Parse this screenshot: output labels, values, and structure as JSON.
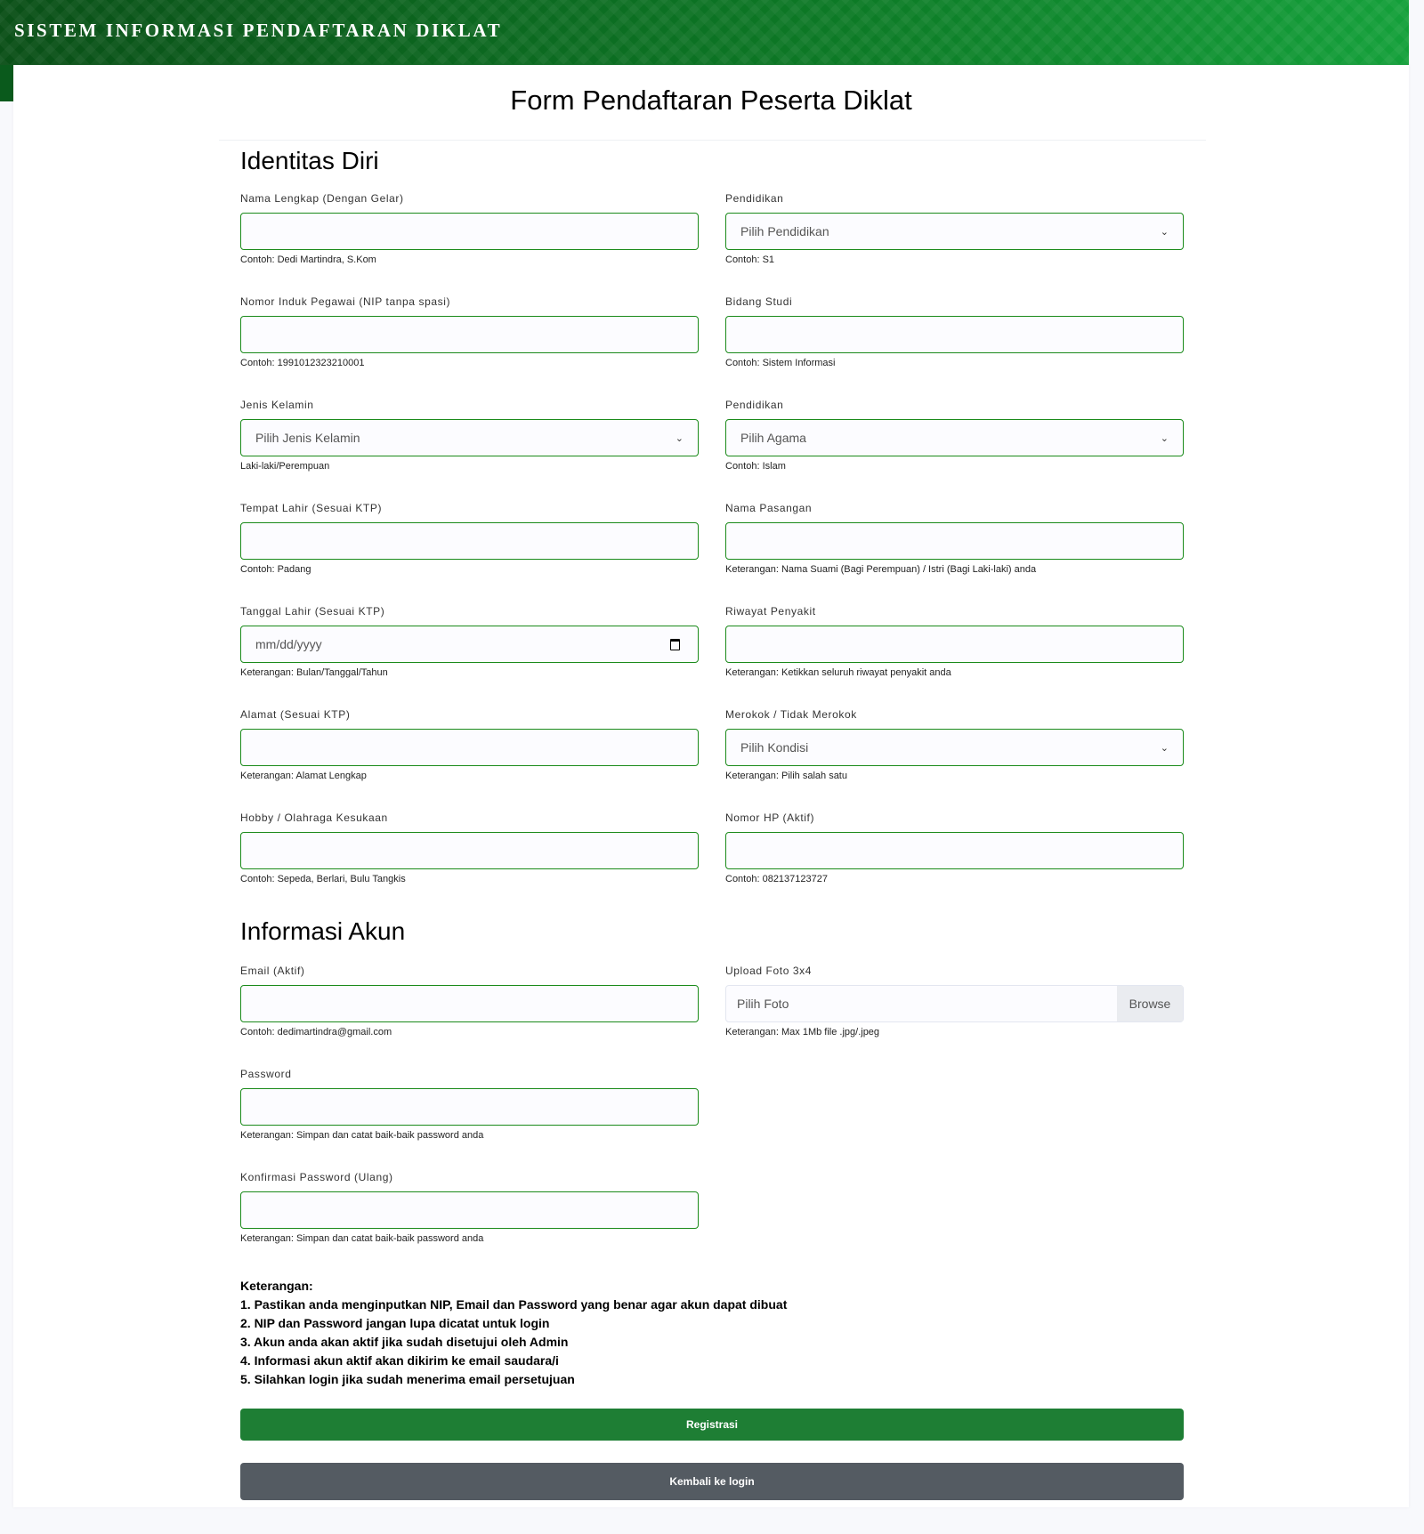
{
  "header": {
    "title": "SISTEM INFORMASI PENDAFTARAN DIKLAT"
  },
  "form": {
    "title": "Form Pendaftaran Peserta Diklat"
  },
  "identitas": {
    "title": "Identitas Diri",
    "fields": [
      {
        "label": "Nama Lengkap (Dengan Gelar)",
        "type": "text",
        "help": "Contoh: Dedi Martindra, S.Kom"
      },
      {
        "label": "Pendidikan",
        "type": "select",
        "placeholder": "Pilih Pendidikan",
        "help": "Contoh: S1"
      },
      {
        "label": "Nomor Induk Pegawai (NIP tanpa spasi)",
        "type": "text",
        "help": "Contoh: 199101232321000​1"
      },
      {
        "label": "Bidang Studi",
        "type": "text",
        "help": "Contoh: Sistem Informasi"
      },
      {
        "label": "Jenis Kelamin",
        "type": "select",
        "placeholder": "Pilih Jenis Kelamin",
        "help": "Laki-laki/Perempuan"
      },
      {
        "label": "Pendidikan",
        "type": "select",
        "placeholder": "Pilih Agama",
        "help": "Contoh: Islam"
      },
      {
        "label": "Tempat Lahir (Sesuai KTP)",
        "type": "text",
        "help": "Contoh: Padang"
      },
      {
        "label": "Nama Pasangan",
        "type": "text",
        "help": "Keterangan: Nama Suami (Bagi Perempuan) / Istri (Bagi Laki-laki) anda"
      },
      {
        "label": "Tanggal Lahir (Sesuai KTP)",
        "type": "date",
        "placeholder": "mm/dd/yyyy",
        "help": "Keterangan: Bulan/Tanggal/Tahun"
      },
      {
        "label": "Riwayat Penyakit",
        "type": "text",
        "help": "Keterangan: Ketikkan seluruh riwayat penyakit anda"
      },
      {
        "label": "Alamat (Sesuai KTP)",
        "type": "text",
        "help": "Keterangan: Alamat Lengkap"
      },
      {
        "label": "Merokok / Tidak Merokok",
        "type": "select",
        "placeholder": "Pilih Kondisi",
        "help": "Keterangan: Pilih salah satu"
      },
      {
        "label": "Hobby / Olahraga Kesukaan",
        "type": "text",
        "help": "Contoh: Sepeda, Berlari, Bulu Tangkis"
      },
      {
        "label": "Nomor HP (Aktif)",
        "type": "text",
        "help": "Contoh: 082137123727"
      }
    ]
  },
  "akun": {
    "title": "Informasi Akun",
    "email": {
      "label": "Email (Aktif)",
      "help": "Contoh: dedimartindra@gmail.com"
    },
    "upload": {
      "label": "Upload Foto 3x4",
      "placeholder": "Pilih Foto",
      "browse": "Browse",
      "help": "Keterangan: Max 1Mb file .jpg/.jpeg"
    },
    "password": {
      "label": "Password",
      "help": "Keterangan: Simpan dan catat baik-baik password anda"
    },
    "konfirmasi": {
      "label": "Konfirmasi Password (Ulang)",
      "help": "Keterangan: Simpan dan catat baik-baik password anda"
    }
  },
  "notes": {
    "title": "Keterangan:",
    "items": [
      "1. Pastikan anda menginputkan NIP, Email dan Password yang benar agar akun dapat dibuat",
      "2. NIP dan Password jangan lupa dicatat untuk login",
      "3. Akun anda akan aktif jika sudah disetujui oleh Admin",
      "4. Informasi akun aktif akan dikirim ke email saudara/i",
      "5. Silahkan login jika sudah menerima email persetujuan"
    ]
  },
  "buttons": {
    "register": "Registrasi",
    "back": "Kembali ke login"
  },
  "colors": {
    "primary": "#1e7e34",
    "secondary": "#545b62",
    "border": "#1a8a1a"
  }
}
